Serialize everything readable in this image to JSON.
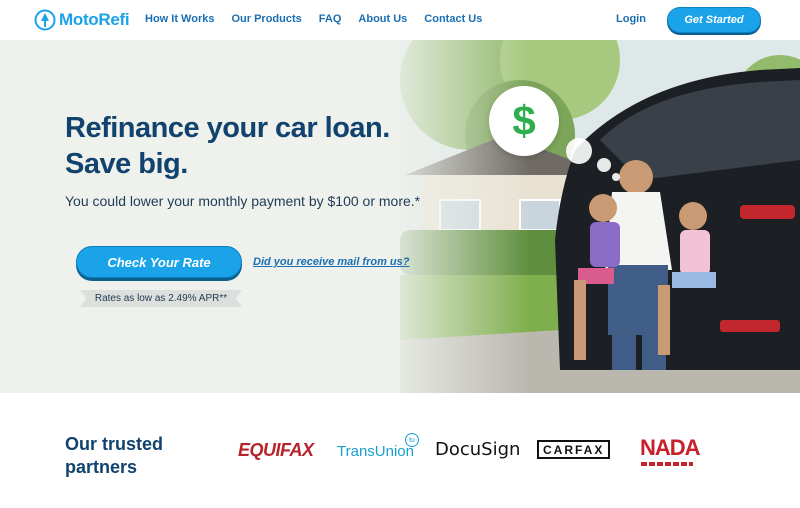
{
  "brand": {
    "name": "MotoRefi",
    "accent": "#1aa3e8",
    "navy": "#12426e"
  },
  "nav": {
    "links": [
      "How It Works",
      "Our Products",
      "FAQ",
      "About Us",
      "Contact Us"
    ],
    "login": "Login",
    "cta": "Get Started"
  },
  "hero": {
    "headline_1": "Refinance your car loan.",
    "headline_2": "Save big.",
    "subline": "You could lower your monthly payment by $100 or more.*",
    "cta": "Check Your Rate",
    "mail_link": "Did you receive mail from us?",
    "rate_note": "Rates as low as 2.49% APR**",
    "bubble_icon": "dollar-sign-icon",
    "bubble_text": "$"
  },
  "partners": {
    "title_1": "Our trusted",
    "title_2": "partners",
    "logos": [
      "EQUIFAX",
      "TransUnion",
      "DocuSign",
      "CARFAX",
      "NADA"
    ]
  }
}
